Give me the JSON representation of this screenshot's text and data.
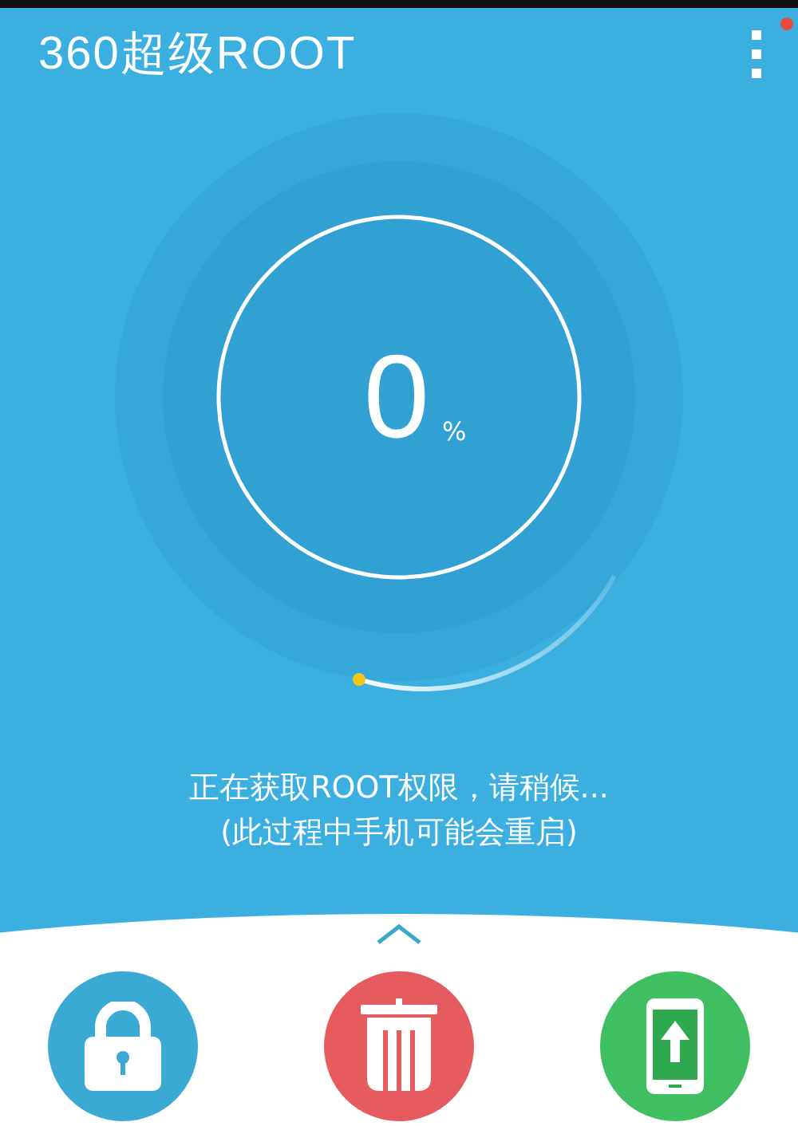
{
  "app_bar": {
    "title": "360超级ROOT",
    "has_notification": true
  },
  "progress": {
    "value": "0",
    "unit": "%"
  },
  "status": {
    "message": "正在获取ROOT权限，请稍候...",
    "note": "(此过程中手机可能会重启)"
  },
  "features": [
    {
      "kind": "lock",
      "color": "#3aa9d4"
    },
    {
      "kind": "trash",
      "color": "#e65b5d"
    },
    {
      "kind": "phone",
      "color": "#3fbf5f"
    }
  ]
}
